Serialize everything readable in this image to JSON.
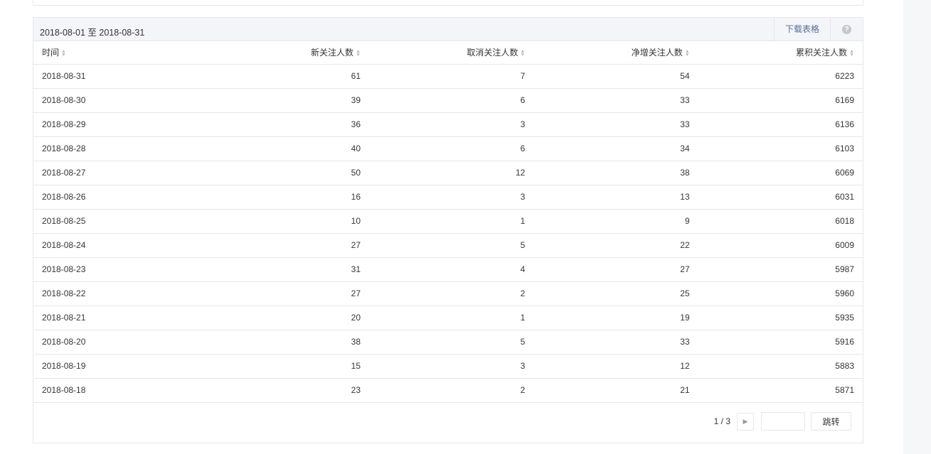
{
  "header": {
    "range": "2018-08-01 至 2018-08-31",
    "download_label": "下载表格",
    "help_icon": "?"
  },
  "columns": [
    "时间",
    "新关注人数",
    "取消关注人数",
    "净增关注人数",
    "累积关注人数"
  ],
  "rows": [
    [
      "2018-08-31",
      "61",
      "7",
      "54",
      "6223"
    ],
    [
      "2018-08-30",
      "39",
      "6",
      "33",
      "6169"
    ],
    [
      "2018-08-29",
      "36",
      "3",
      "33",
      "6136"
    ],
    [
      "2018-08-28",
      "40",
      "6",
      "34",
      "6103"
    ],
    [
      "2018-08-27",
      "50",
      "12",
      "38",
      "6069"
    ],
    [
      "2018-08-26",
      "16",
      "3",
      "13",
      "6031"
    ],
    [
      "2018-08-25",
      "10",
      "1",
      "9",
      "6018"
    ],
    [
      "2018-08-24",
      "27",
      "5",
      "22",
      "6009"
    ],
    [
      "2018-08-23",
      "31",
      "4",
      "27",
      "5987"
    ],
    [
      "2018-08-22",
      "27",
      "2",
      "25",
      "5960"
    ],
    [
      "2018-08-21",
      "20",
      "1",
      "19",
      "5935"
    ],
    [
      "2018-08-20",
      "38",
      "5",
      "33",
      "5916"
    ],
    [
      "2018-08-19",
      "15",
      "3",
      "12",
      "5883"
    ],
    [
      "2018-08-18",
      "23",
      "2",
      "21",
      "5871"
    ]
  ],
  "pagination": {
    "page_text": "1 / 3",
    "jump_label": "跳转",
    "jump_value": ""
  }
}
